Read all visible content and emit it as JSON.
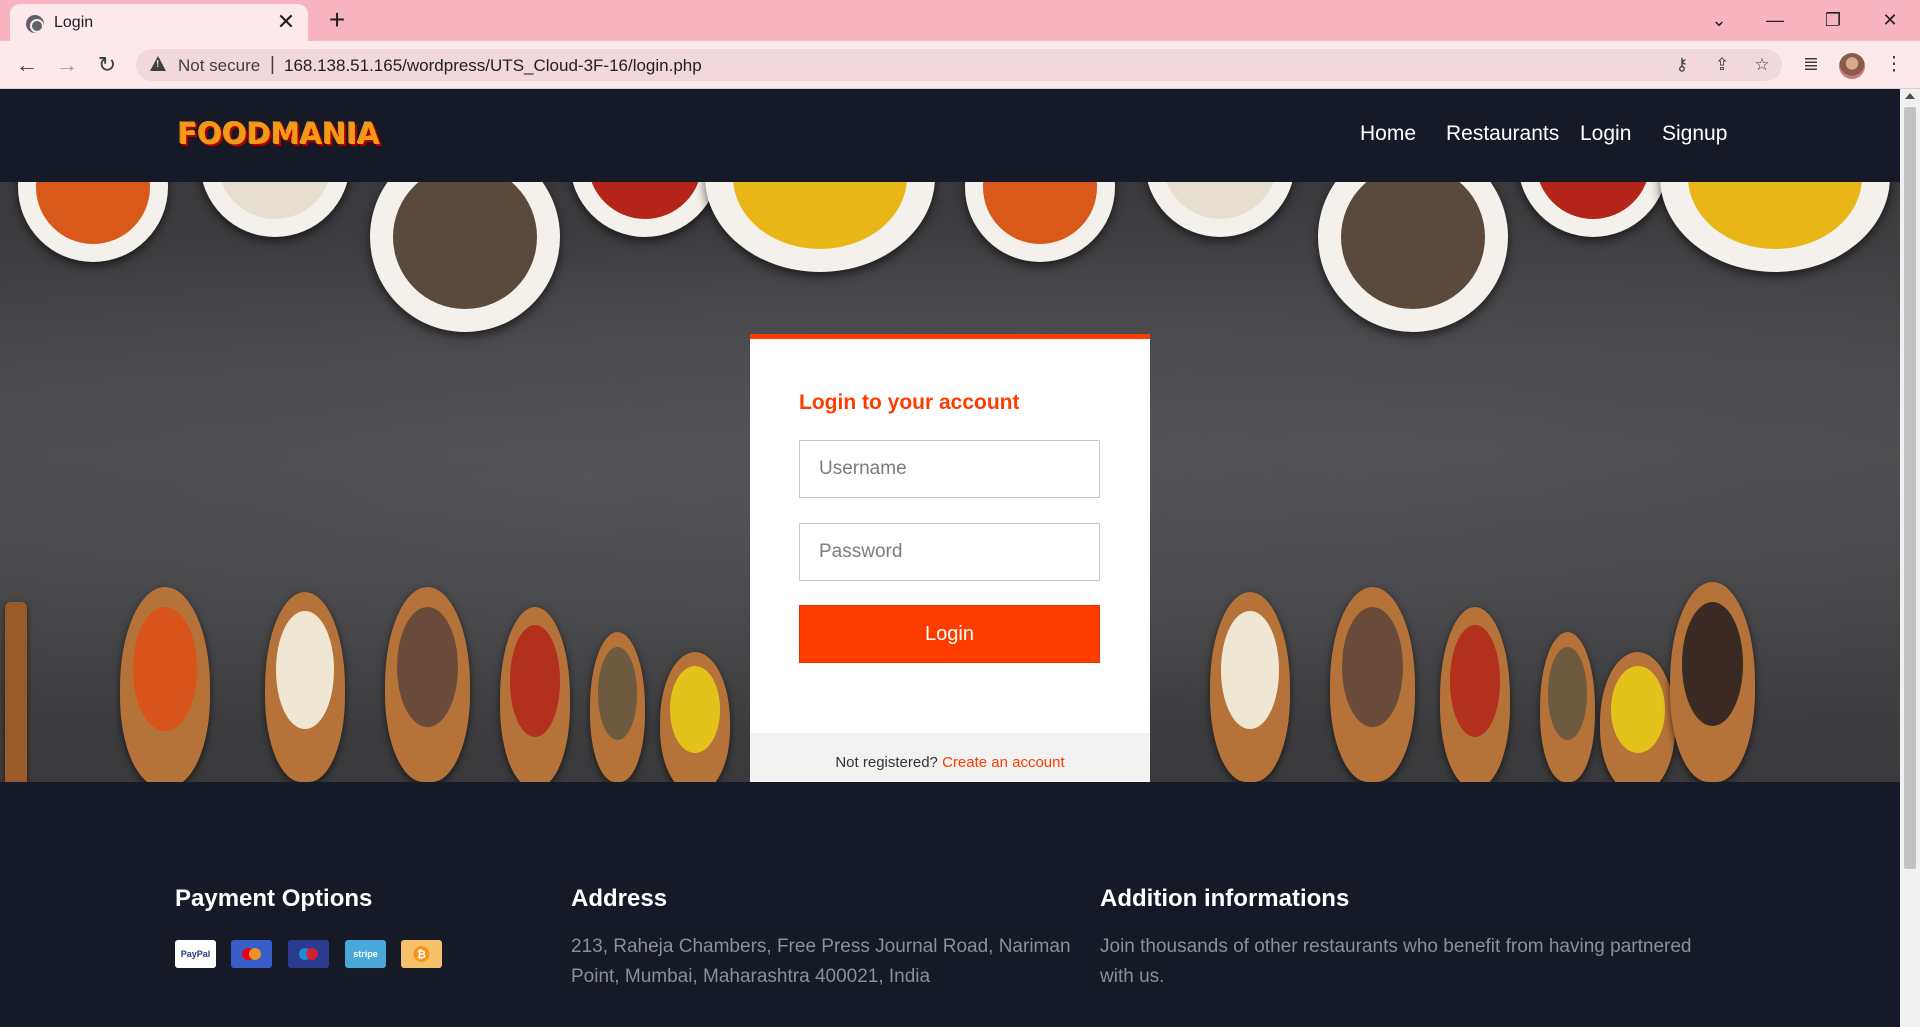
{
  "browser": {
    "tab_title": "Login",
    "new_tab": "+",
    "close_tab": "✕",
    "security_label": "Not secure",
    "url_separator": "|",
    "url": "168.138.51.165/wordpress/UTS_Cloud-3F-16/login.php",
    "icons": [
      "back-icon",
      "forward-icon",
      "reload-icon",
      "key-icon",
      "share-icon",
      "star-icon",
      "media-icon",
      "menu-icon"
    ]
  },
  "site": {
    "logo": "FOODMANIA",
    "nav": [
      "Home",
      "Restaurants",
      "Login",
      "Signup"
    ]
  },
  "login": {
    "heading": "Login to your account",
    "username_placeholder": "Username",
    "password_placeholder": "Password",
    "button": "Login",
    "not_registered": "Not registered?",
    "create_account": "Create an account"
  },
  "footer": {
    "payment_heading": "Payment Options",
    "payment_methods": [
      "PayPal",
      "Mastercard",
      "Maestro",
      "stripe",
      "Bitcoin"
    ],
    "address_heading": "Address",
    "address_line1": "213, Raheja Chambers, Free Press Journal Road, Nariman",
    "address_line2": "Point, Mumbai, Maharashtra 400021, India",
    "info_heading": "Addition informations",
    "info_line1": "Join thousands of other restaurants who benefit from having partnered",
    "info_line2": "with us."
  },
  "colors": {
    "accent": "#ff3c00",
    "header_bg": "#151a26",
    "browser_frame": "#f8b4c0"
  }
}
